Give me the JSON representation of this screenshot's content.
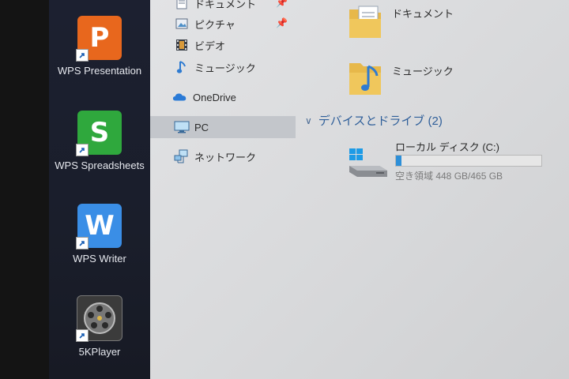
{
  "desktop": {
    "icons": [
      {
        "label": "WPS Presentation",
        "icon": "wps-presentation-icon",
        "glyph": "P",
        "color": "#e8671d"
      },
      {
        "label": "WPS Spreadsheets",
        "icon": "wps-spreadsheets-icon",
        "glyph": "S",
        "color": "#2fa83d"
      },
      {
        "label": "WPS Writer",
        "icon": "wps-writer-icon",
        "glyph": "W",
        "color": "#3a8ee6"
      },
      {
        "label": "5KPlayer",
        "icon": "5kplayer-icon",
        "glyph": "",
        "color": "#3b3b3b"
      }
    ]
  },
  "nav": {
    "items": [
      {
        "label": "ドキュメント",
        "icon": "documents-icon",
        "pinned": true
      },
      {
        "label": "ピクチャ",
        "icon": "pictures-icon",
        "pinned": true
      },
      {
        "label": "ビデオ",
        "icon": "videos-icon",
        "pinned": false
      },
      {
        "label": "ミュージック",
        "icon": "music-icon",
        "pinned": false
      },
      {
        "label": "OneDrive",
        "icon": "onedrive-icon",
        "pinned": false
      },
      {
        "label": "PC",
        "icon": "pc-icon",
        "pinned": false,
        "selected": true
      },
      {
        "label": "ネットワーク",
        "icon": "network-icon",
        "pinned": false
      }
    ]
  },
  "content": {
    "folders": [
      {
        "label": "ドキュメント",
        "icon": "documents-folder-icon"
      },
      {
        "label": "ミュージック",
        "icon": "music-folder-icon"
      }
    ],
    "devices_group": {
      "label": "デバイスとドライブ (2)"
    },
    "drive": {
      "name": "ローカル ディスク (C:)",
      "space_text": "空き領域 448 GB/465 GB",
      "used_fraction": 0.037
    }
  },
  "colors": {
    "accent": "#2d8fd8",
    "group_header": "#2f5f9a",
    "selected_nav": "#c3c6cb"
  }
}
